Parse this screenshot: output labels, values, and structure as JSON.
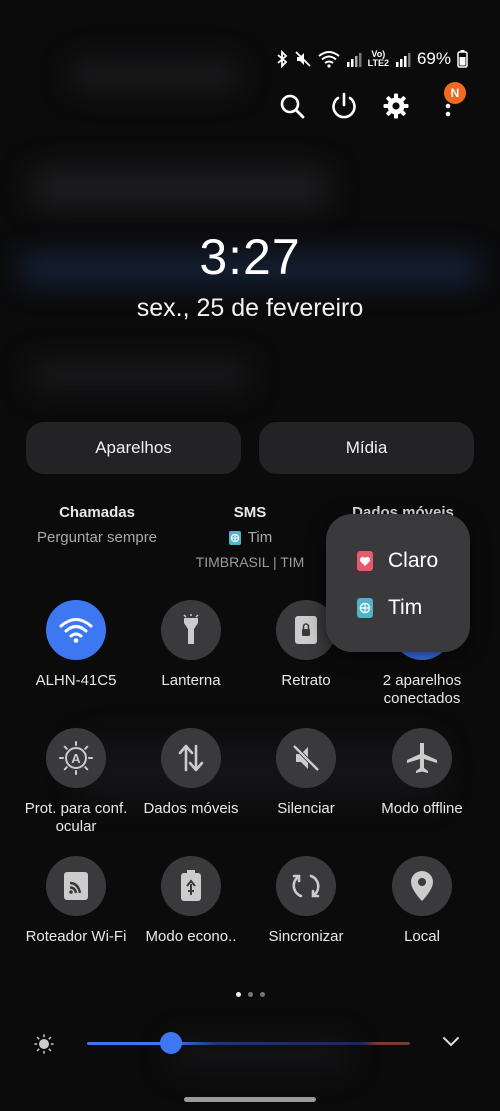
{
  "status_bar": {
    "icons": [
      "bluetooth-icon",
      "mute-icon",
      "wifi-icon",
      "signal-icon",
      "volte-lte2-icon"
    ],
    "volte_text": "Vo)",
    "lte_text": "LTE2",
    "battery_percent": "69%"
  },
  "top_actions": {
    "icons": [
      "search-icon",
      "power-icon",
      "settings-icon",
      "more-icon"
    ],
    "notification_badge": "N"
  },
  "clock": {
    "time": "3:27",
    "date": "sex., 25 de fevereiro"
  },
  "buttons": {
    "devices": "Aparelhos",
    "media": "Mídia"
  },
  "sim_settings": {
    "calls": {
      "title": "Chamadas",
      "value": "Perguntar sempre"
    },
    "sms": {
      "title": "SMS",
      "value": "Tim"
    },
    "mobile_data": {
      "title": "Dados móveis"
    },
    "carrier_line": "TIMBRASIL | TIM"
  },
  "sim_popup": {
    "options": [
      "Claro",
      "Tim"
    ]
  },
  "tiles": [
    {
      "label": "ALHN-41C5",
      "icon": "wifi-icon",
      "active": true
    },
    {
      "label": "Lanterna",
      "icon": "flashlight-icon",
      "active": false
    },
    {
      "label": "Retrato",
      "icon": "portrait-lock-icon",
      "active": false
    },
    {
      "label": "2 aparelhos conectados",
      "icon": "bluetooth-icon",
      "active": true
    },
    {
      "label": "Prot. para conf. ocular",
      "icon": "eye-comfort-icon",
      "active": false
    },
    {
      "label": "Dados móveis",
      "icon": "mobile-data-icon",
      "active": false
    },
    {
      "label": "Silenciar",
      "icon": "mute-icon",
      "active": false
    },
    {
      "label": "Modo offline",
      "icon": "airplane-icon",
      "active": false
    },
    {
      "label": "Roteador Wi-Fi",
      "icon": "hotspot-icon",
      "active": false
    },
    {
      "label": "Modo econo..",
      "icon": "power-saving-icon",
      "active": false
    },
    {
      "label": "Sincronizar",
      "icon": "sync-icon",
      "active": false
    },
    {
      "label": "Local",
      "icon": "location-icon",
      "active": false
    }
  ],
  "page_dots": {
    "count": 3,
    "current": 1
  },
  "brightness": {
    "level": 0.26
  },
  "colors": {
    "accent": "#3d78f2",
    "tile_bg": "#3a3a3c",
    "badge": "#f06b1f"
  }
}
